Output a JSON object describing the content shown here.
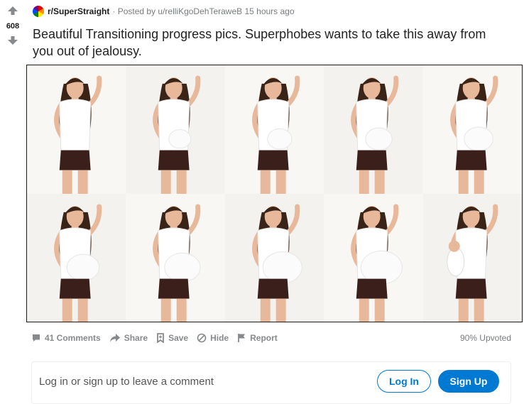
{
  "vote": {
    "score": "608"
  },
  "post": {
    "subreddit": "r/SuperStraight",
    "posted_by": "Posted by u/relliKgoDehTeraweB 15 hours ago",
    "title": "Beautiful Transitioning progress pics. Superphobes wants to take this away from you out of jealousy."
  },
  "actions": {
    "comments": "41 Comments",
    "share": "Share",
    "save": "Save",
    "hide": "Hide",
    "report": "Report",
    "upvoted": "90% Upvoted"
  },
  "comment_prompt": {
    "text": "Log in or sign up to leave a comment",
    "login_label": "Log In",
    "signup_label": "Sign Up"
  },
  "colors": {
    "accent": "#0079d3",
    "muted_text": "#878a8c",
    "shirt": "#ffffff",
    "shorts": "#3b1f1a",
    "hair": "#3a2418",
    "skin": "#e8b89a"
  },
  "image": {
    "frames": [
      {
        "bump": 0.0
      },
      {
        "bump": 0.1
      },
      {
        "bump": 0.2
      },
      {
        "bump": 0.3
      },
      {
        "bump": 0.4
      },
      {
        "bump": 0.55
      },
      {
        "bump": 0.7
      },
      {
        "bump": 0.85
      },
      {
        "bump": 0.95
      },
      {
        "bump": 0.0,
        "baby": true
      }
    ]
  }
}
